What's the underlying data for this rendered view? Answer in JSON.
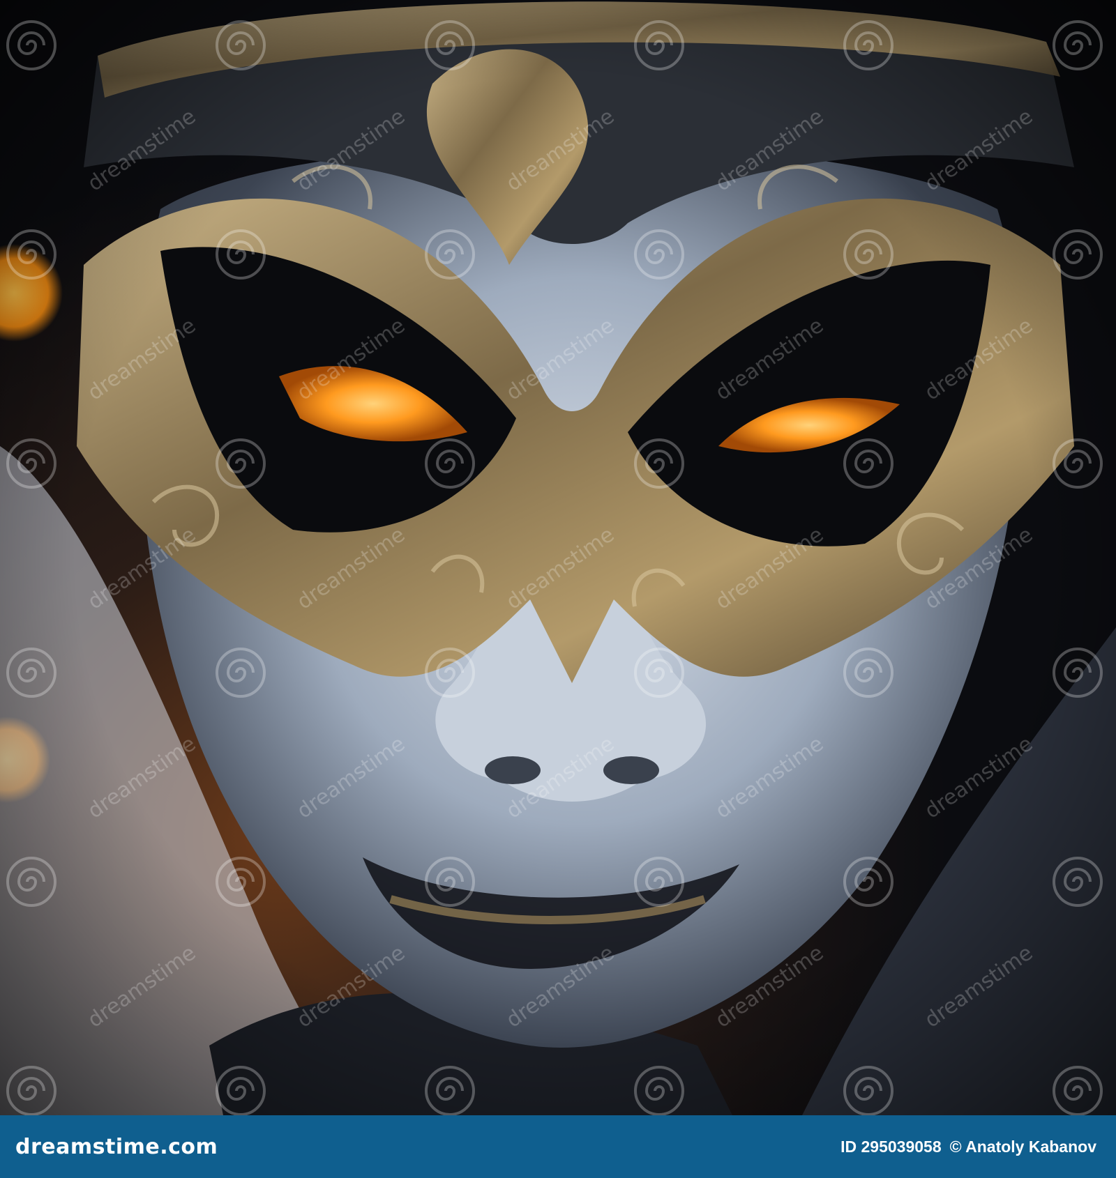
{
  "image": {
    "subject": "mask",
    "colors": {
      "background": "#0e0f12",
      "mask_gold": "#8a7550",
      "mask_face": "#b7c3d3",
      "eye_glow": "#ff9a1f",
      "footer_bar": "#0f5f8f"
    }
  },
  "watermark": {
    "text": "dreamstime"
  },
  "footer": {
    "logo": "dreamstime.com",
    "id_text": "ID 295039058",
    "copyright": "© Anatoly Kabanov"
  }
}
